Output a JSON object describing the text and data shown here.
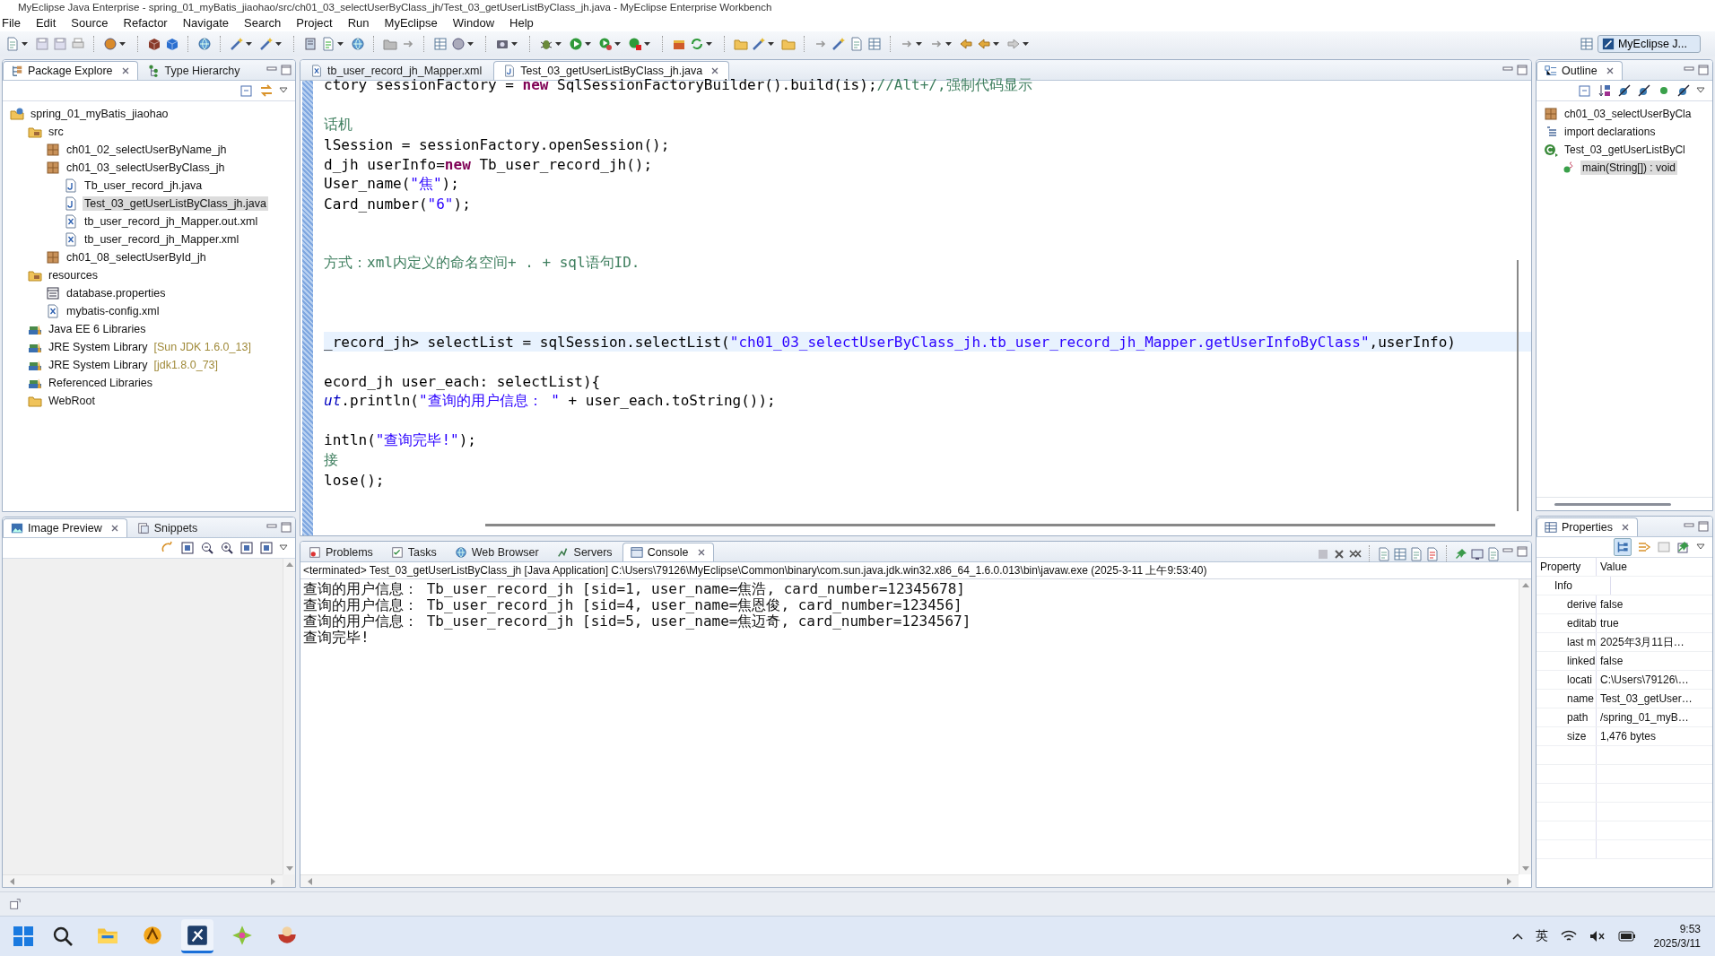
{
  "window": {
    "title": "MyEclipse Java Enterprise - spring_01_myBatis_jiaohao/src/ch01_03_selectUserByClass_jh/Test_03_getUserListByClass_jh.java - MyEclipse Enterprise Workbench"
  },
  "menu": [
    "File",
    "Edit",
    "Source",
    "Refactor",
    "Navigate",
    "Search",
    "Project",
    "Run",
    "MyEclipse",
    "Window",
    "Help"
  ],
  "perspective": {
    "label": "MyEclipse J..."
  },
  "package_explorer": {
    "tabs": [
      {
        "label": "Package Explore",
        "selected": true
      },
      {
        "label": "Type Hierarchy",
        "selected": false
      }
    ],
    "tree": [
      {
        "label": "spring_01_myBatis_jiaohao",
        "kind": "project",
        "selected": false,
        "children": [
          {
            "label": "src",
            "kind": "source-folder",
            "selected": false,
            "children": [
              {
                "label": "ch01_02_selectUserByName_jh",
                "kind": "package",
                "selected": false
              },
              {
                "label": "ch01_03_selectUserByClass_jh",
                "kind": "package",
                "selected": false,
                "children": [
                  {
                    "label": "Tb_user_record_jh.java",
                    "kind": "java",
                    "selected": false
                  },
                  {
                    "label": "Test_03_getUserListByClass_jh.java",
                    "kind": "java",
                    "selected": true
                  },
                  {
                    "label": "tb_user_record_jh_Mapper.out.xml",
                    "kind": "xml",
                    "selected": false
                  },
                  {
                    "label": "tb_user_record_jh_Mapper.xml",
                    "kind": "xml",
                    "selected": false
                  }
                ]
              },
              {
                "label": "ch01_08_selectUserById_jh",
                "kind": "package",
                "selected": false
              }
            ]
          },
          {
            "label": "resources",
            "kind": "source-folder",
            "selected": false,
            "children": [
              {
                "label": "database.properties",
                "kind": "properties",
                "selected": false
              },
              {
                "label": "mybatis-config.xml",
                "kind": "xml",
                "selected": false
              }
            ]
          },
          {
            "label": "Java EE 6 Libraries",
            "kind": "library",
            "selected": false
          },
          {
            "label": "JRE System Library",
            "decoration": "[Sun JDK 1.6.0_13]",
            "kind": "library",
            "selected": false
          },
          {
            "label": "JRE System Library",
            "decoration": "[jdk1.8.0_73]",
            "kind": "library",
            "selected": false
          },
          {
            "label": "Referenced Libraries",
            "kind": "library",
            "selected": false
          },
          {
            "label": "WebRoot",
            "kind": "folder",
            "selected": false
          }
        ]
      }
    ]
  },
  "image_preview": {
    "tabs": [
      {
        "label": "Image Preview",
        "selected": true
      },
      {
        "label": "Snippets",
        "selected": false
      }
    ]
  },
  "editor": {
    "tabs": [
      {
        "label": "tb_user_record_jh_Mapper.xml",
        "kind": "xml",
        "selected": false
      },
      {
        "label": "Test_03_getUserListByClass_jh.java",
        "kind": "java",
        "selected": true
      }
    ],
    "lines": [
      {
        "highlighted": false,
        "segments": [
          {
            "kind": "code",
            "text": "ctory sessionFactory = "
          },
          {
            "kind": "keyword",
            "text": "new"
          },
          {
            "kind": "code",
            "text": " SqlSessionFactoryBuilder().build(is);"
          },
          {
            "kind": "comment",
            "text": "//Alt+/,强制代码显示"
          }
        ]
      },
      {
        "highlighted": false
      },
      {
        "highlighted": false,
        "segments": [
          {
            "kind": "comment",
            "text": "话机"
          }
        ]
      },
      {
        "highlighted": false,
        "segments": [
          {
            "kind": "code",
            "text": "lSession = sessionFactory.openSession();"
          }
        ]
      },
      {
        "highlighted": false,
        "segments": [
          {
            "kind": "code",
            "text": "d_jh userInfo="
          },
          {
            "kind": "keyword",
            "text": "new"
          },
          {
            "kind": "code",
            "text": " Tb_user_record_jh();"
          }
        ]
      },
      {
        "highlighted": false,
        "segments": [
          {
            "kind": "code",
            "text": "User_name("
          },
          {
            "kind": "string",
            "text": "\"焦\""
          },
          {
            "kind": "code",
            "text": ");"
          }
        ]
      },
      {
        "highlighted": false,
        "segments": [
          {
            "kind": "code",
            "text": "Card_number("
          },
          {
            "kind": "string",
            "text": "\"6\""
          },
          {
            "kind": "code",
            "text": ");"
          }
        ]
      },
      {
        "highlighted": false
      },
      {
        "highlighted": false
      },
      {
        "highlighted": false,
        "segments": [
          {
            "kind": "comment",
            "text": "方式：xml内定义的命名空间+ . + sql语句ID."
          }
        ]
      },
      {
        "highlighted": false
      },
      {
        "highlighted": false
      },
      {
        "highlighted": false
      },
      {
        "highlighted": true,
        "segments": [
          {
            "kind": "code",
            "text": "_record_jh> selectList = sqlSession.selectList("
          },
          {
            "kind": "string",
            "text": "\"ch01_03_selectUserByClass_jh.tb_user_record_jh_Mapper.getUserInfoByClass\""
          },
          {
            "kind": "code",
            "text": ",userInfo)"
          }
        ]
      },
      {
        "highlighted": false
      },
      {
        "highlighted": false,
        "segments": [
          {
            "kind": "code",
            "text": "ecord_jh user_each: selectList){"
          }
        ]
      },
      {
        "highlighted": false,
        "segments": [
          {
            "kind": "field",
            "text": "ut"
          },
          {
            "kind": "code",
            "text": ".println("
          },
          {
            "kind": "string",
            "text": "\"查询的用户信息： \""
          },
          {
            "kind": "code",
            "text": " + user_each.toString());"
          }
        ]
      },
      {
        "highlighted": false
      },
      {
        "highlighted": false,
        "segments": [
          {
            "kind": "code",
            "text": "intln("
          },
          {
            "kind": "string",
            "text": "\"查询完毕!\""
          },
          {
            "kind": "code",
            "text": ");"
          }
        ]
      },
      {
        "highlighted": false,
        "segments": [
          {
            "kind": "comment",
            "text": "接"
          }
        ]
      },
      {
        "highlighted": false,
        "segments": [
          {
            "kind": "code",
            "text": "lose();"
          }
        ]
      }
    ]
  },
  "console": {
    "tabs": [
      {
        "label": "Problems",
        "kind": "problems",
        "selected": false
      },
      {
        "label": "Tasks",
        "kind": "tasks",
        "selected": false
      },
      {
        "label": "Web Browser",
        "kind": "browser",
        "selected": false
      },
      {
        "label": "Servers",
        "kind": "servers",
        "selected": false
      },
      {
        "label": "Console",
        "kind": "console",
        "selected": true
      }
    ],
    "status": "<terminated> Test_03_getUserListByClass_jh [Java Application] C:\\Users\\79126\\MyEclipse\\Common\\binary\\com.sun.java.jdk.win32.x86_64_1.6.0.013\\bin\\javaw.exe (2025-3-11 上午9:53:40)",
    "output": [
      "查询的用户信息： Tb_user_record_jh [sid=1, user_name=焦浩, card_number=12345678]",
      "查询的用户信息： Tb_user_record_jh [sid=4, user_name=焦恩俊, card_number=123456]",
      "查询的用户信息： Tb_user_record_jh [sid=5, user_name=焦迈奇, card_number=1234567]",
      "查询完毕!"
    ]
  },
  "outline": {
    "title": "Outline",
    "items": [
      {
        "label": "ch01_03_selectUserByCla",
        "kind": "package",
        "selected": false
      },
      {
        "label": "import declarations",
        "kind": "imports",
        "selected": false
      },
      {
        "label": "Test_03_getUserListByCl",
        "kind": "class",
        "selected": false,
        "children": [
          {
            "label": "main(String[]) : void",
            "kind": "method",
            "selected": true
          }
        ]
      }
    ]
  },
  "properties": {
    "title": "Properties",
    "columns": [
      "Property",
      "Value"
    ],
    "category": "Info",
    "rows": [
      {
        "property": "derive",
        "value": "false"
      },
      {
        "property": "editab",
        "value": "true"
      },
      {
        "property": "last m",
        "value": "2025年3月11日…"
      },
      {
        "property": "linked",
        "value": "false"
      },
      {
        "property": "locati",
        "value": "C:\\Users\\79126\\…"
      },
      {
        "property": "name",
        "value": "Test_03_getUser…"
      },
      {
        "property": "path",
        "value": "/spring_01_myB…"
      },
      {
        "property": "size",
        "value": "1,476  bytes"
      }
    ]
  },
  "taskbar": {
    "apps": [
      {
        "kind": "folder",
        "selected": false
      },
      {
        "kind": "app-orange",
        "selected": false
      },
      {
        "kind": "ide",
        "selected": true
      },
      {
        "kind": "app-sparkle",
        "selected": false
      },
      {
        "kind": "app-bowl",
        "selected": false
      }
    ],
    "input_method": "英",
    "time": "9:53",
    "date": "2025/3/11"
  }
}
